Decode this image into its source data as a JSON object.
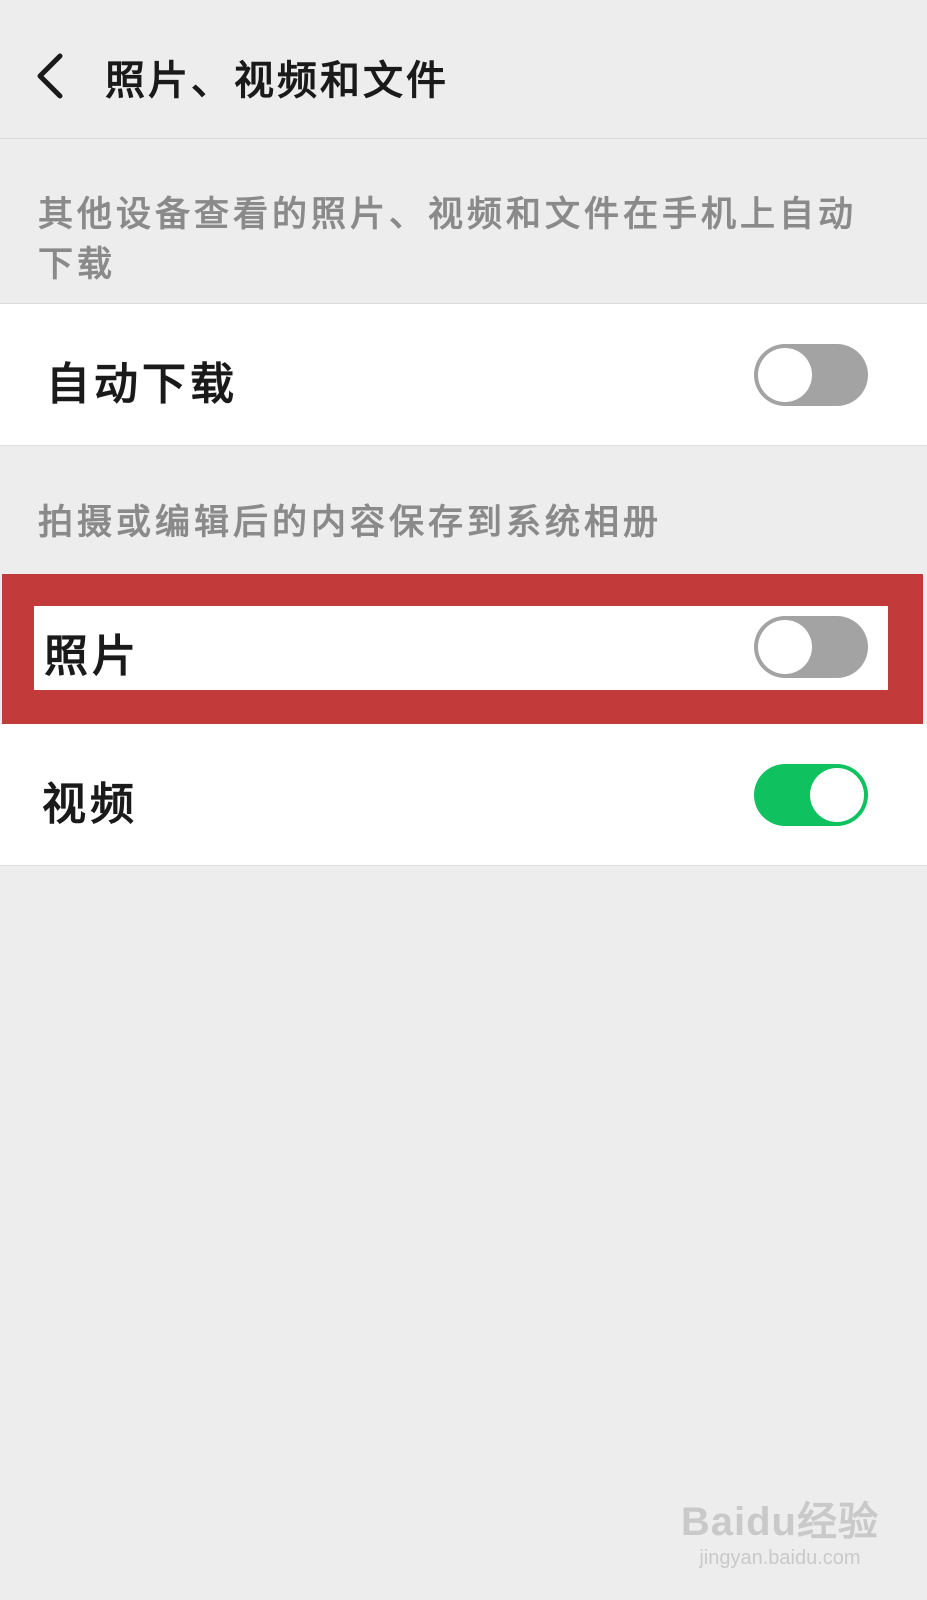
{
  "header": {
    "title": "照片、视频和文件",
    "back_icon": "chevron-left-icon"
  },
  "sections": [
    {
      "description": "其他设备查看的照片、视频和文件在手机上自动下载",
      "items": [
        {
          "label": "自动下载",
          "enabled": false
        }
      ]
    },
    {
      "description": "拍摄或编辑后的内容保存到系统相册",
      "items": [
        {
          "label": "照片",
          "enabled": false,
          "highlighted": true
        },
        {
          "label": "视频",
          "enabled": true
        }
      ]
    }
  ],
  "colors": {
    "toggle_on": "#0fc15f",
    "toggle_off": "#a3a3a3",
    "highlight": "#c23a3a",
    "background": "#ededed"
  },
  "watermark": {
    "logo": "Baidu经验",
    "url": "jingyan.baidu.com"
  }
}
